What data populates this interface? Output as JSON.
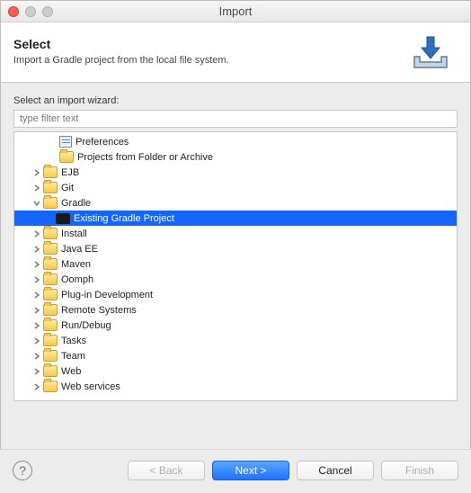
{
  "window": {
    "title": "Import"
  },
  "header": {
    "title": "Select",
    "subtitle": "Import a Gradle project from the local file system."
  },
  "wizard": {
    "label": "Select an import wizard:",
    "filter_placeholder": "type filter text"
  },
  "tree": {
    "top_items": [
      {
        "label": "Preferences",
        "icon": "pref"
      },
      {
        "label": "Projects from Folder or Archive",
        "icon": "folder"
      }
    ],
    "folders": [
      {
        "label": "EJB",
        "expanded": false
      },
      {
        "label": "Git",
        "expanded": false
      },
      {
        "label": "Gradle",
        "expanded": true,
        "children": [
          {
            "label": "Existing Gradle Project",
            "selected": true
          }
        ]
      },
      {
        "label": "Install",
        "expanded": false
      },
      {
        "label": "Java EE",
        "expanded": false
      },
      {
        "label": "Maven",
        "expanded": false
      },
      {
        "label": "Oomph",
        "expanded": false
      },
      {
        "label": "Plug-in Development",
        "expanded": false
      },
      {
        "label": "Remote Systems",
        "expanded": false
      },
      {
        "label": "Run/Debug",
        "expanded": false
      },
      {
        "label": "Tasks",
        "expanded": false
      },
      {
        "label": "Team",
        "expanded": false
      },
      {
        "label": "Web",
        "expanded": false
      },
      {
        "label": "Web services",
        "expanded": false
      }
    ]
  },
  "footer": {
    "back": "< Back",
    "next": "Next >",
    "cancel": "Cancel",
    "finish": "Finish"
  }
}
